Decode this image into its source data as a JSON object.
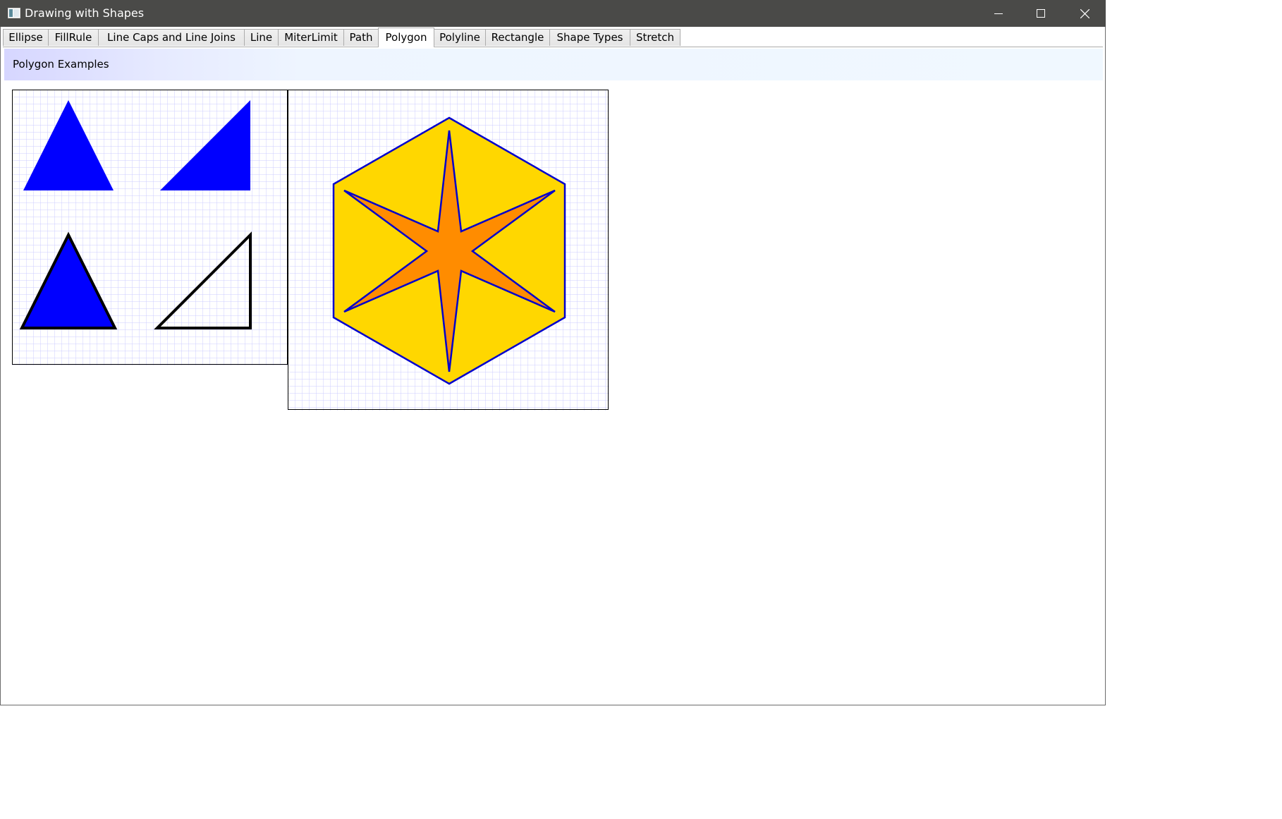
{
  "window": {
    "title": "Drawing with Shapes",
    "titlebar_color": "#4a4a48",
    "controls": {
      "minimize_icon": "minimize-icon",
      "maximize_icon": "maximize-icon",
      "close_icon": "close-icon"
    }
  },
  "tabs": [
    {
      "label": "Ellipse",
      "selected": false
    },
    {
      "label": "FillRule",
      "selected": false
    },
    {
      "label": "Line Caps and Line Joins",
      "selected": false
    },
    {
      "label": "Line",
      "selected": false
    },
    {
      "label": "MiterLimit",
      "selected": false
    },
    {
      "label": "Path",
      "selected": false
    },
    {
      "label": "Polygon",
      "selected": true
    },
    {
      "label": "Polyline",
      "selected": false
    },
    {
      "label": "Rectangle",
      "selected": false
    },
    {
      "label": "Shape Types",
      "selected": false
    },
    {
      "label": "Stretch",
      "selected": false
    }
  ],
  "content": {
    "header": "Polygon Examples",
    "colors": {
      "grid_line": "#ccccff",
      "canvas_border": "#000000",
      "triangle_fill": "#0000ff",
      "outline_stroke": "#000000",
      "hexagon_fill": "#ffd700",
      "star_fill": "#ff8c00",
      "shape_stroke": "#0000cd"
    }
  }
}
